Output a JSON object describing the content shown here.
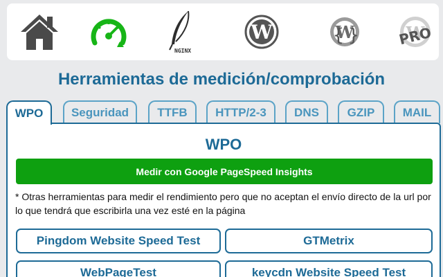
{
  "icons": [
    "home-icon",
    "speedometer-icon",
    "nginx-feather-icon",
    "wordpress-icon",
    "wordpress-plugins-icon",
    "wordpress-pro-icon"
  ],
  "nginx_text": "NGINX",
  "pro_text": "PRO",
  "colors": {
    "accent": "#1d6a96",
    "tab_border": "#5ba3c7",
    "green": "#0ea010",
    "background": "#e9eaec"
  },
  "heading": "Herramientas de medición/comprobación",
  "tabs": [
    {
      "label": "WPO",
      "active": true
    },
    {
      "label": "Seguridad",
      "active": false
    },
    {
      "label": "TTFB",
      "active": false
    },
    {
      "label": "HTTP/2-3",
      "active": false
    },
    {
      "label": "DNS",
      "active": false
    },
    {
      "label": "GZIP",
      "active": false
    },
    {
      "label": "MAIL",
      "active": false
    }
  ],
  "panel": {
    "title": "WPO",
    "primary_button": "Medir con Google PageSpeed Insights",
    "note": "* Otras herramientas para medir el rendimiento pero que no aceptan el envío directo de la url por lo que tendrá que escribirla una vez esté en la página",
    "tools": [
      "Pingdom Website Speed Test",
      "GTMetrix",
      "WebPageTest",
      "keycdn Website Speed Test"
    ]
  }
}
